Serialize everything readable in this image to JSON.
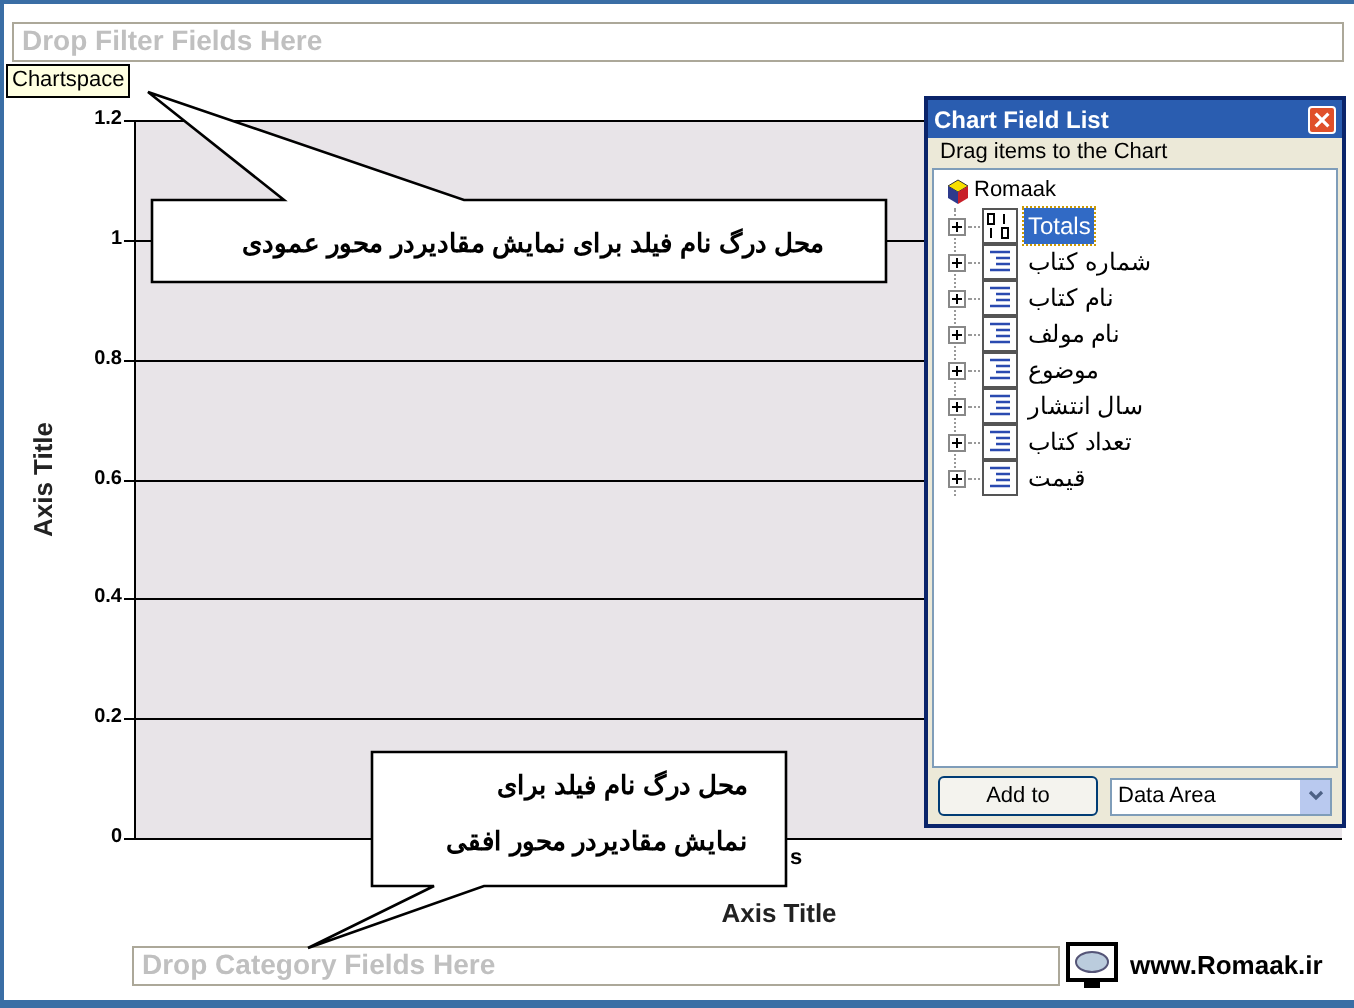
{
  "filter_drop_zone": {
    "placeholder": "Drop Filter Fields Here"
  },
  "tooltip": "Chartspace",
  "chart": {
    "chart_data": {
      "type": "bar",
      "grid": true,
      "xlabel": "Axis Title",
      "ylabel": "Axis Title",
      "categories": [
        "s"
      ],
      "values": [
        null
      ],
      "ylim": [
        0,
        1.2
      ],
      "yticks": [
        {
          "value": 0,
          "label": "0"
        },
        {
          "value": 0.2,
          "label": "0.2"
        },
        {
          "value": 0.4,
          "label": "0.4"
        },
        {
          "value": 0.6,
          "label": "0.6"
        },
        {
          "value": 0.8,
          "label": "0.8"
        },
        {
          "value": 1,
          "label": "1"
        },
        {
          "value": 1.2,
          "label": "1.2"
        }
      ]
    }
  },
  "callouts": [
    {
      "kind": "top",
      "text": "محل درگ نام فیلد برای نمایش مقادیردر محور عمودی"
    },
    {
      "kind": "bottom",
      "lines": [
        "محل درگ نام فیلد برای",
        "نمایش مقادیردر محور افقی"
      ]
    }
  ],
  "category_drop_zone": {
    "placeholder": "Drop Category Fields Here"
  },
  "watermark_site": "www.Romaak.ir",
  "field_list": {
    "title": "Chart Field List",
    "header": "Drag items to the Chart",
    "root": {
      "label": "Romaak",
      "children": [
        {
          "label": "Totals",
          "kind": "measure",
          "selected": true,
          "expanded": false
        },
        {
          "label": "شماره کتاب",
          "kind": "field",
          "selected": false,
          "expanded": false
        },
        {
          "label": "نام کتاب",
          "kind": "field",
          "selected": false,
          "expanded": false
        },
        {
          "label": "نام مولف",
          "kind": "field",
          "selected": false,
          "expanded": false
        },
        {
          "label": "موضوع",
          "kind": "field",
          "selected": false,
          "expanded": false
        },
        {
          "label": "سال انتشار",
          "kind": "field",
          "selected": false,
          "expanded": false
        },
        {
          "label": "تعداد کتاب",
          "kind": "field",
          "selected": false,
          "expanded": false
        },
        {
          "label": "قیمت",
          "kind": "field",
          "selected": false,
          "expanded": false
        }
      ]
    },
    "add_button": "Add to",
    "area_select": "Data Area"
  }
}
